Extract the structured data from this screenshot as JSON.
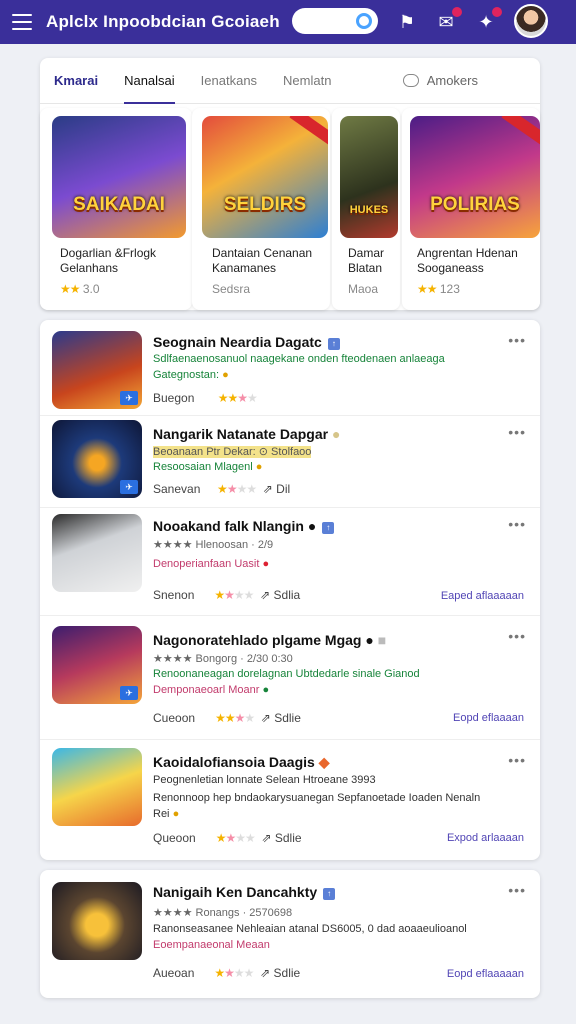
{
  "header": {
    "title": "Aplclx Inpoobdcian Gcoiaeh",
    "icons": [
      "menu-icon",
      "search-icon",
      "store-icon",
      "notification-icon",
      "people-icon",
      "avatar"
    ]
  },
  "tabs": {
    "items": [
      "Kmarai",
      "Nanalsai",
      "Ienatkans",
      "Nemlatn"
    ],
    "right_label": "Amokers"
  },
  "featured": [
    {
      "art_title": "SAIKADAI",
      "line1": "Dogarlian &Frlogk",
      "line2": "Gelanhans",
      "rating": "3.0",
      "stars": 2
    },
    {
      "art_title": "SELDIRS",
      "line1": "Dantaian Cenanan",
      "line2": "Kanamanes",
      "sub": "Sedsra"
    },
    {
      "art_title": "HUKES",
      "line1": "Damar",
      "line2": "Blatan",
      "sub": "Maoa"
    },
    {
      "art_title": "POLIRIAS",
      "line1": "Angrentan Hdenan",
      "line2": "Sooganeass",
      "rating": "123",
      "stars": 2
    }
  ],
  "list": [
    {
      "title": "Seognain Neardia Dagatc",
      "l1": "Sdlfaenaenosanuol naagekane onden fteodenaen anlaeaga",
      "l2": "Gategnostan:",
      "foot": "Buegon",
      "stars": 3,
      "link": ""
    },
    {
      "title": "Nangarik Natanate Dapgar",
      "l1": "Beoanaan  Ptr Dekar:  ⊙ Stolfaoo",
      "l2": "Resoosaian  Mlagenl",
      "foot": "Sanevan",
      "stars": 2,
      "extra": "Dil",
      "link": ""
    },
    {
      "title": "Nooakand falk Nlangin",
      "l1": "★★★★ Hlenoosan  · 2/9",
      "l2": "Denoperianfaan Uasit",
      "foot": "Snenon",
      "stars": 2,
      "extra": "Sdlia",
      "link": "Eaped aflaaaaan"
    },
    {
      "title": "Nagonoratehlado plgame Mgag",
      "l1": "★★★★ Bongorg  · 2/30 0:30",
      "l2": "Renoonaneagan dorelagnan  Ubtdedarle sinale Gianod",
      "l3": "Demponaeoarl Moanr",
      "foot": "Cueoon",
      "stars": 3,
      "extra": "Sdlie",
      "link": "Eopd eflaaaan"
    },
    {
      "title": "Kaoidalofiansoia Daagis",
      "l1": "Peognenletian lonnate Selean Htroeane 3993",
      "l2": "Renonnoop hep bndaokarysuanegan Sepfanoetade Ioaden Nenaln",
      "l3": "Rei",
      "foot": "Queoon",
      "stars": 2,
      "extra": "Sdlie",
      "link": "Expod arlaaaan"
    },
    {
      "title": "Nanigaih Ken Dancahkty",
      "l1": "★★★★ Ronangs  · 2570698",
      "l2": "Ranonseasanee Nehleaian atanal DS6005, 0 dad aoaaeulioanol",
      "l3": "Eoempanaeonal Meaan",
      "foot": "Aueoan",
      "stars": 2,
      "extra": "Sdlie",
      "link": "Eopd eflaaaaan"
    }
  ],
  "colors": {
    "accent": "#3a2f9a",
    "link": "#5145b5",
    "star": "#f5b301",
    "green": "#17843a"
  }
}
